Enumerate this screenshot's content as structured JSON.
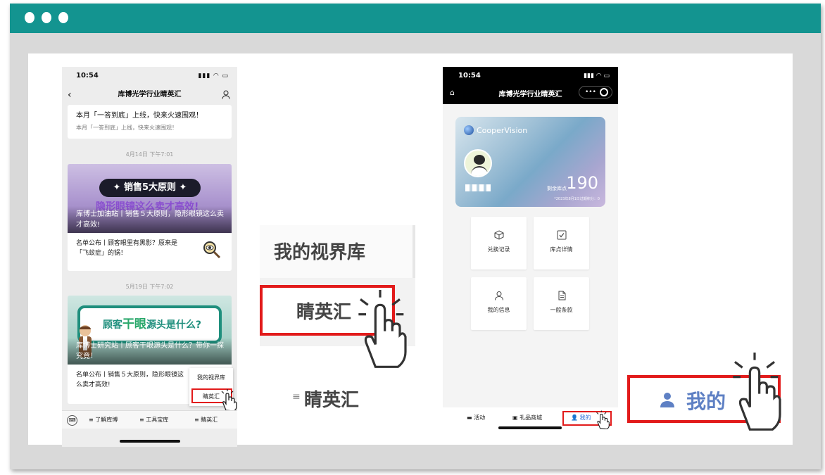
{
  "phone1": {
    "status_time": "10:54",
    "nav_title": "库博光学行业睛英汇",
    "card1_title": "本月「一答到底」上线，快来火速围观！",
    "card1_sub": "本月「一答到底」上线，快来火速围观！",
    "stamp1": "4月14日 下午7:01",
    "art1_pill": "✦ 销售5大原则 ✦",
    "art1_big": "隐形眼镜这么卖才高效!",
    "art1_caption": "库博士加油站丨销售５大原则，隐形眼镜这么卖才高效!",
    "art1_sub": "名单公布丨顾客眼里有黑影？原来是「飞蚊症」的锅！",
    "stamp2": "5月19日 下午7:02",
    "art2_bubble_a": "顾客",
    "art2_bubble_b": "干眼",
    "art2_bubble_c": "源头是什么?",
    "art2_caption": "库博士研究站丨顾客干眼源头是什么？带你一探究竟！",
    "art2_sub": "名单公布丨销售５大原则，隐形眼镜这么卖才高效!",
    "popmenu": [
      "我的视界库",
      "睛英汇"
    ],
    "tabs": [
      "了解库博",
      "工具宝库",
      "睛英汇"
    ]
  },
  "zoom1": {
    "top_label": "我的视界库",
    "mid_label": "睛英汇",
    "bottom_label": "睛英汇"
  },
  "phone2": {
    "status_time": "10:54",
    "nav_title": "库博光学行业睛英汇",
    "brand": "CooperVision",
    "points_value": "190",
    "points_label": "剩余库点",
    "points_note": "*2023年8月1日过期积分：0",
    "tiles": [
      "兑换记录",
      "库点详情",
      "我的信息",
      "一般条款"
    ],
    "tabs": [
      "活动",
      "礼品商城",
      "我的"
    ]
  },
  "zoom2": {
    "label": "我的"
  },
  "colors": {
    "titlebar": "#139490",
    "highlight_red": "#e21b1b",
    "active_blue": "#2f6fd6"
  }
}
